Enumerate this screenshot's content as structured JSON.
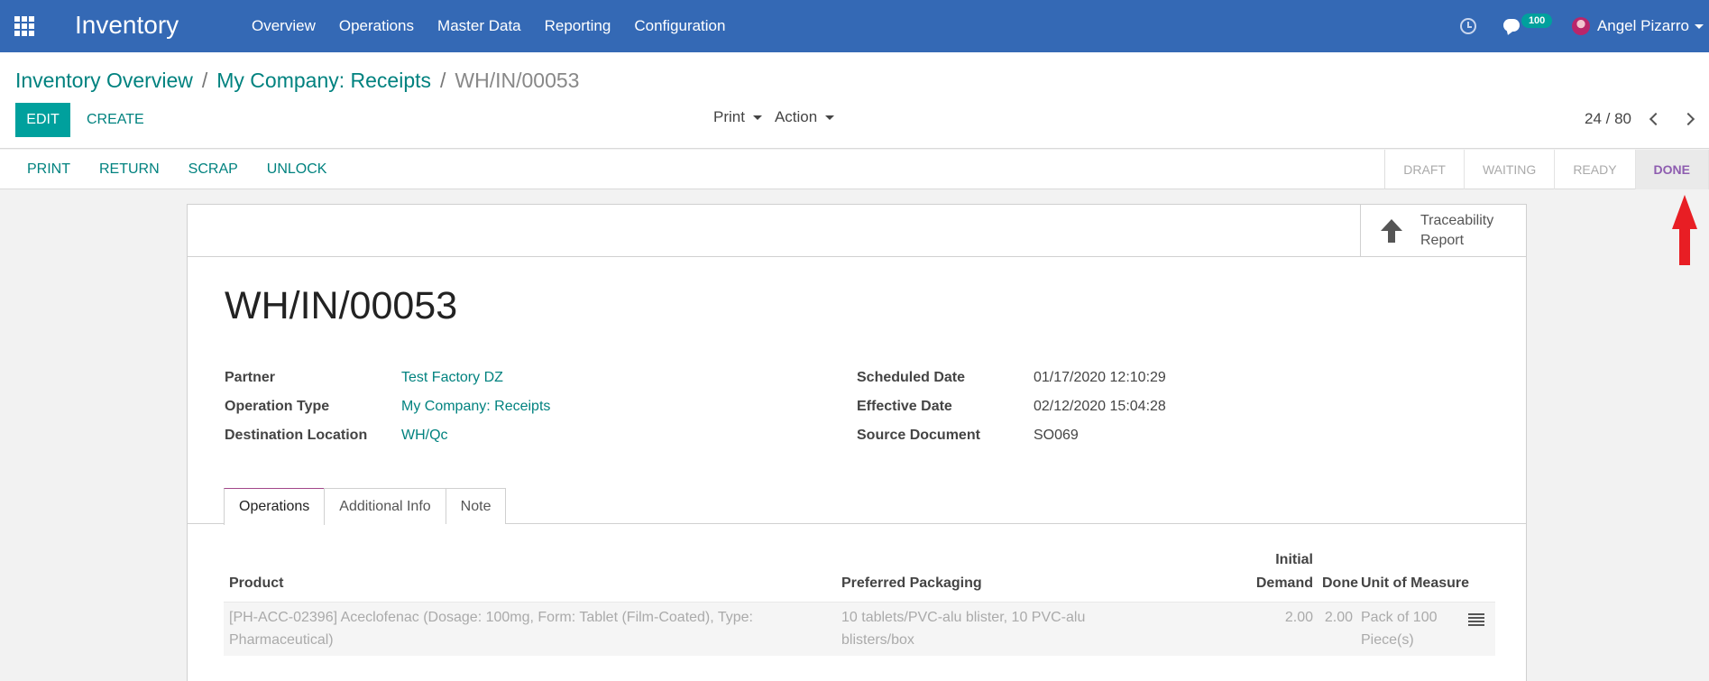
{
  "navbar": {
    "app_title": "Inventory",
    "menu": [
      "Overview",
      "Operations",
      "Master Data",
      "Reporting",
      "Configuration"
    ],
    "chat_count": "100",
    "user_name": "Angel Pizarro"
  },
  "breadcrumb": {
    "items": [
      "Inventory Overview",
      "My Company: Receipts"
    ],
    "current": "WH/IN/00053"
  },
  "control": {
    "edit_label": "EDIT",
    "create_label": "CREATE",
    "print_label": "Print",
    "action_label": "Action",
    "pager": "24 / 80"
  },
  "statusbar": {
    "actions": [
      "PRINT",
      "RETURN",
      "SCRAP",
      "UNLOCK"
    ],
    "stages": [
      "DRAFT",
      "WAITING",
      "READY",
      "DONE"
    ],
    "current_stage": "DONE"
  },
  "smart_button": {
    "label": "Traceability Report"
  },
  "record": {
    "title": "WH/IN/00053",
    "fields_left": [
      {
        "label": "Partner",
        "value": "Test Factory DZ"
      },
      {
        "label": "Operation Type",
        "value": "My Company: Receipts"
      },
      {
        "label": "Destination Location",
        "value": "WH/Qc"
      }
    ],
    "fields_right": [
      {
        "label": "Scheduled Date",
        "value": "01/17/2020 12:10:29"
      },
      {
        "label": "Effective Date",
        "value": "02/12/2020 15:04:28"
      },
      {
        "label": "Source Document",
        "value": "SO069"
      }
    ]
  },
  "tabs": [
    "Operations",
    "Additional Info",
    "Note"
  ],
  "operations_table": {
    "headers": {
      "product": "Product",
      "packaging": "Preferred Packaging",
      "initial_demand_1": "Initial",
      "initial_demand_2": "Demand",
      "done": "Done",
      "uom": "Unit of Measure"
    },
    "rows": [
      {
        "product_1": "[PH-ACC-02396] Aceclofenac (Dosage: 100mg, Form: Tablet (Film-Coated), Type:",
        "product_2": "Pharmaceutical)",
        "packaging_1": "10 tablets/PVC-alu blister, 10 PVC-alu",
        "packaging_2": "blisters/box",
        "initial_demand": "2.00",
        "done": "2.00",
        "uom_1": "Pack of 100",
        "uom_2": "Piece(s)"
      }
    ]
  },
  "colors": {
    "navbar": "#3469b5",
    "primary": "#00a09d",
    "link": "#00827f",
    "done_stage": "#8e5db0",
    "annotation_arrow": "#e81e24"
  }
}
